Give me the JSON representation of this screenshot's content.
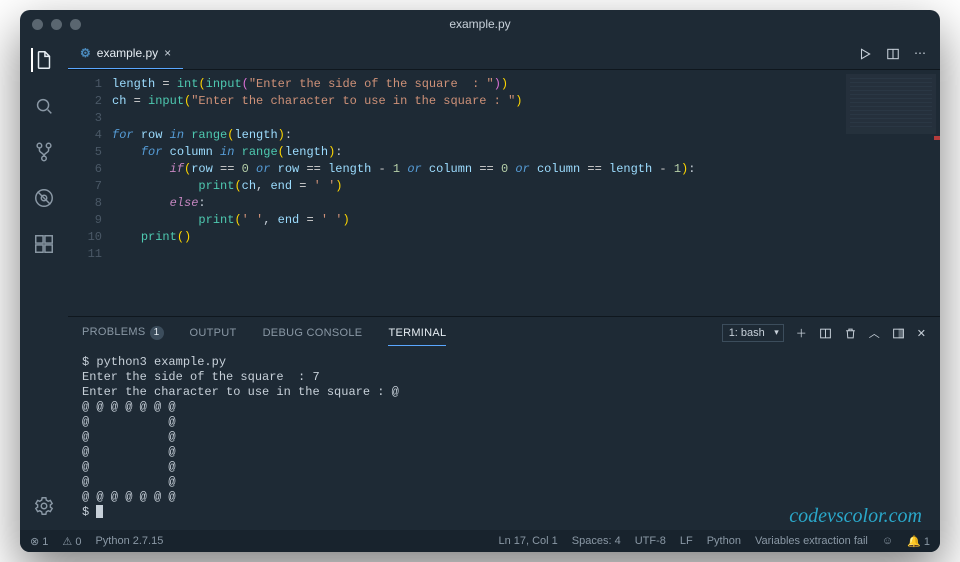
{
  "window": {
    "title": "example.py"
  },
  "tabs": {
    "file": "example.py"
  },
  "code": {
    "lines": [
      1,
      2,
      3,
      4,
      5,
      6,
      7,
      8,
      9,
      10,
      11
    ]
  },
  "src": {
    "l1_var": "length",
    "l1_fn1": "int",
    "l1_fn2": "input",
    "l1_str": "\"Enter the side of the square  : \"",
    "l2_var": "ch",
    "l2_fn": "input",
    "l2_str": "\"Enter the character to use in the square : \"",
    "l4_kw": "for",
    "l4_v": "row",
    "l4_in": "in",
    "l4_fn": "range",
    "l4_arg": "length",
    "l5_kw": "for",
    "l5_v": "column",
    "l5_in": "in",
    "l5_fn": "range",
    "l5_arg": "length",
    "l6_if": "if",
    "l6_body": "row == 0 or row == length - 1 or column == 0 or column == length - 1",
    "l7_fn": "print",
    "l7_a1": "ch",
    "l7_kw": "end",
    "l7_str": "' '",
    "l8_else": "else",
    "l9_fn": "print",
    "l9_a1": "' '",
    "l9_kw": "end",
    "l9_str": "' '",
    "l10_fn": "print"
  },
  "panel": {
    "problems": "PROBLEMS",
    "problems_count": "1",
    "output": "OUTPUT",
    "debug": "DEBUG CONSOLE",
    "terminal": "TERMINAL",
    "select": "1: bash"
  },
  "terminal": {
    "line1": "$ python3 example.py",
    "line2": "Enter the side of the square  : 7",
    "line3": "Enter the character to use in the square : @",
    "line4": "@ @ @ @ @ @ @",
    "line5": "@           @",
    "line6": "@           @",
    "line7": "@           @",
    "line8": "@           @",
    "line9": "@           @",
    "line10": "@ @ @ @ @ @ @",
    "prompt": "$ "
  },
  "watermark": "codevscolor.com",
  "status": {
    "errors": "1",
    "warnings": "0",
    "python": "Python 2.7.15",
    "pos": "Ln 17, Col 1",
    "spaces": "Spaces: 4",
    "enc": "UTF-8",
    "eol": "LF",
    "lang": "Python",
    "msg": "Variables extraction fail",
    "bell": "1"
  }
}
